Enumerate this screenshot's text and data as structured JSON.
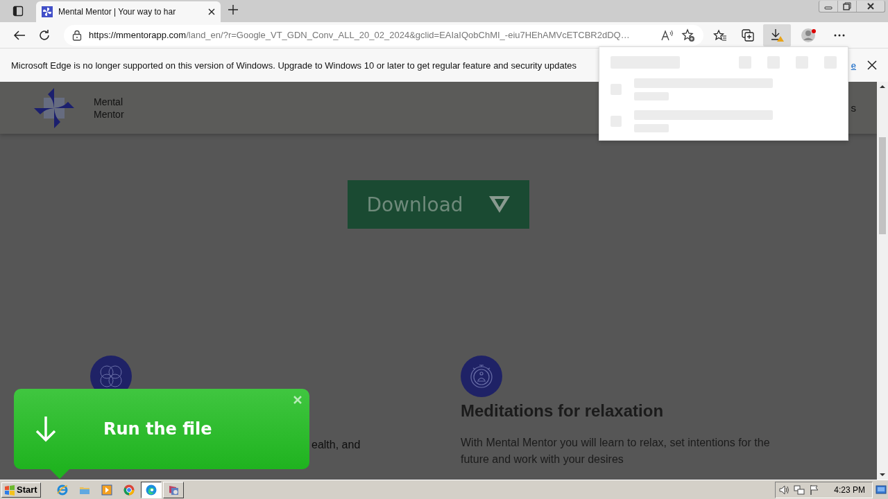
{
  "browser": {
    "tabs": [
      {
        "title": "Mental Mentor | Your way to har",
        "selected": true
      }
    ],
    "address": {
      "host": "https://mmentorapp.com",
      "path": "/land_en/?r=Google_VT_GDN_Conv_ALL_20_02_2024&gclid=EAIaIQobChMI_-eiu7HEhAMVcETCBR2dDQ…"
    },
    "downloads_open": true
  },
  "info_bar": {
    "message": "Microsoft Edge is no longer supported on this version of Windows. Upgrade to Windows 10 or later to get regular feature and security updates",
    "link": "e"
  },
  "site": {
    "logo_text": "Mental Mentor",
    "nav_fragment": "s",
    "download_button": "Download",
    "features": [
      {
        "text": "ealth, and"
      },
      {
        "title": "Meditations for relaxation",
        "text": "With Mental Mentor you will learn to relax, set intentions for the future and work with your desires"
      }
    ]
  },
  "popup": {
    "title": "Run the file"
  },
  "taskbar": {
    "start": "Start",
    "apps": [
      {
        "kind": "ie",
        "selected": false
      },
      {
        "kind": "folder",
        "selected": false
      },
      {
        "kind": "media",
        "selected": false
      },
      {
        "kind": "chrome",
        "selected": false
      },
      {
        "kind": "edge",
        "selected": true
      },
      {
        "kind": "app",
        "selected": false
      }
    ],
    "clock": "4:23 PM"
  }
}
